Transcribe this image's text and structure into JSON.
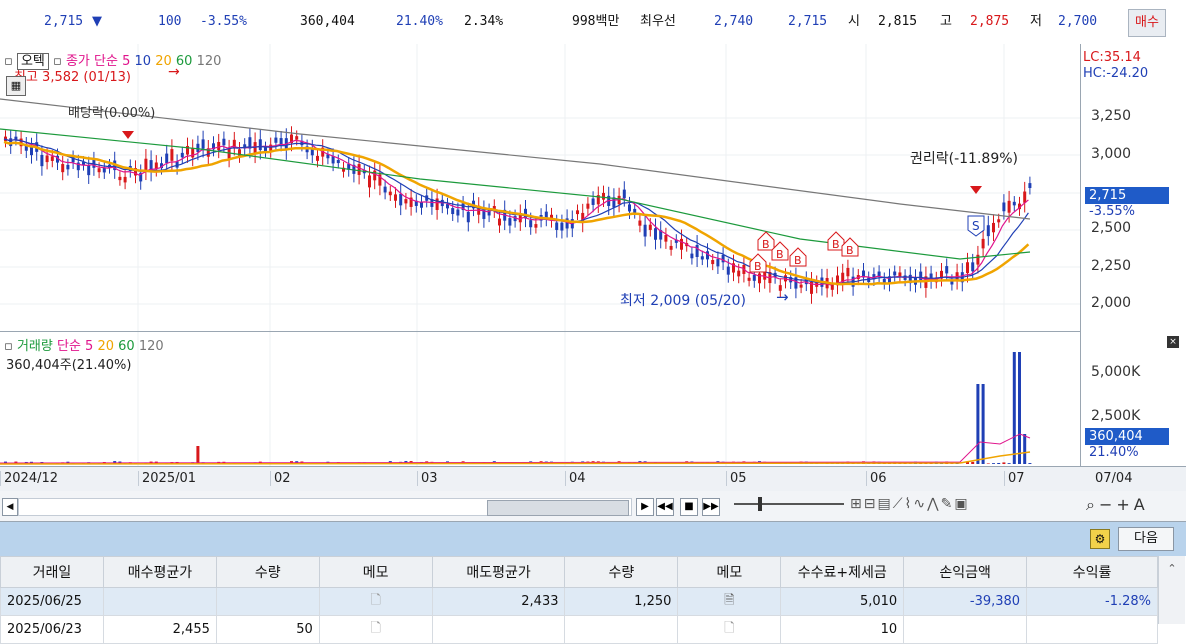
{
  "quote": {
    "price": "2,715",
    "price_arrow": "▼",
    "change": "100",
    "change_pct": "-3.55%",
    "volume": "360,404",
    "volume_ratio": "21.40%",
    "turnover": "2.34%",
    "amount": "998백만",
    "best_label": "최우선",
    "best_ask": "2,740",
    "best_bid": "2,715",
    "open_label": "시",
    "open": "2,815",
    "high_label": "고",
    "high": "2,875",
    "low_label": "저",
    "low": "2,700",
    "buy_button": "매수"
  },
  "price_chart": {
    "legend_tab": "오텍",
    "legend_series": "종가 단순",
    "ma_periods": [
      "5",
      "10",
      "20",
      "60",
      "120"
    ],
    "ma_colors": [
      "#e0148c",
      "#1f3fb5",
      "#f0a400",
      "#1c9a3c",
      "#777777"
    ],
    "high_annotation": "최고 3,582 (01/13)",
    "low_annotation": "최저 2,009 (05/20)",
    "dividend_annotation": "배당락(0.00%)",
    "rights_annotation": "권리락(-11.89%)",
    "lc": "LC:35.14",
    "hc": "HC:-24.20",
    "y_ticks": [
      "3,250",
      "3,000",
      "2,750",
      "2,500",
      "2,250",
      "2,000"
    ],
    "current_tag": "2,715",
    "current_pct": "-3.55%",
    "signal_b": "B",
    "signal_s": "S"
  },
  "volume_chart": {
    "legend_title": "거래량",
    "legend_series": "단순",
    "ma_periods": [
      "5",
      "20",
      "60",
      "120"
    ],
    "subtitle": "360,404주(21.40%)",
    "y_ticks": [
      "5,000K",
      "2,500K"
    ],
    "current_tag": "360,404",
    "current_pct": "21.40%"
  },
  "x_axis": [
    "2024/12",
    "2025/01",
    "02",
    "03",
    "04",
    "05",
    "06",
    "07",
    "07/04"
  ],
  "toolbar": {
    "next_button": "다음"
  },
  "trade_table": {
    "columns": [
      "거래일",
      "매수평균가",
      "수량",
      "메모",
      "매도평균가",
      "수량",
      "메모",
      "수수료+제세금",
      "손익금액",
      "수익률"
    ],
    "rows": [
      [
        "2025/06/25",
        "",
        "",
        "",
        "2,433",
        "1,250",
        "",
        "5,010",
        "-39,380",
        "-1.28%"
      ],
      [
        "2025/06/23",
        "2,455",
        "50",
        "",
        "",
        "",
        "",
        "10",
        "",
        ""
      ]
    ]
  }
}
